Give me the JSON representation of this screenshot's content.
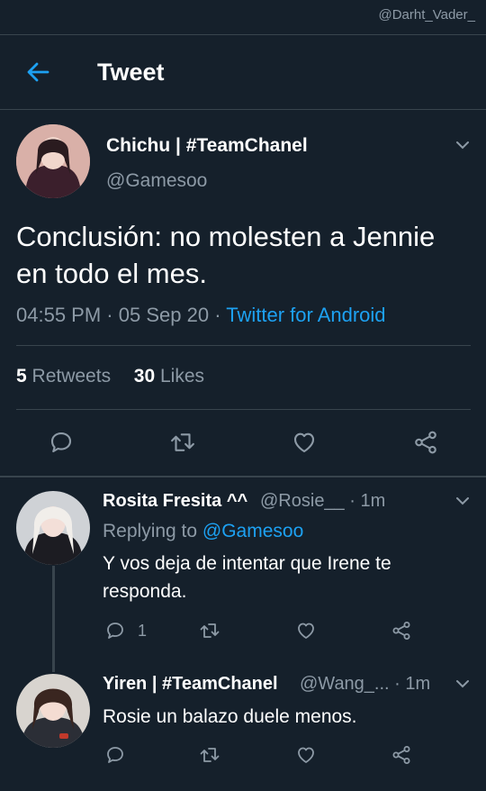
{
  "watermark": "@Darht_Vader_",
  "header": {
    "title": "Tweet"
  },
  "tweet": {
    "author_name": "Chichu | #TeamChanel",
    "author_handle": "@Gamesoo",
    "text": "Conclusión: no molesten a Jennie en todo el mes.",
    "time": "04:55 PM",
    "date": "05 Sep 20",
    "source": "Twitter for Android",
    "retweets_count": "5",
    "retweets_label": "Retweets",
    "likes_count": "30",
    "likes_label": "Likes"
  },
  "replies": [
    {
      "author_name": "Rosita Fresita ^^",
      "author_handle": "@Rosie__",
      "time": "· 1m",
      "replying_prefix": "Replying to",
      "replying_to": "@Gamesoo",
      "text": "Y vos deja de intentar que Irene te responda.",
      "reply_count": "1"
    },
    {
      "author_name": "Yiren | #TeamChanel",
      "author_handle": "@Wang_...",
      "time": "· 1m",
      "text": "Rosie un balazo duele menos."
    }
  ],
  "colors": {
    "background": "#15202b",
    "accent": "#1da1f2",
    "muted": "#8d9aa6",
    "divider": "#38444d"
  },
  "icons": [
    "back-arrow-icon",
    "chevron-down-icon",
    "reply-icon",
    "retweet-icon",
    "like-icon",
    "share-icon"
  ]
}
